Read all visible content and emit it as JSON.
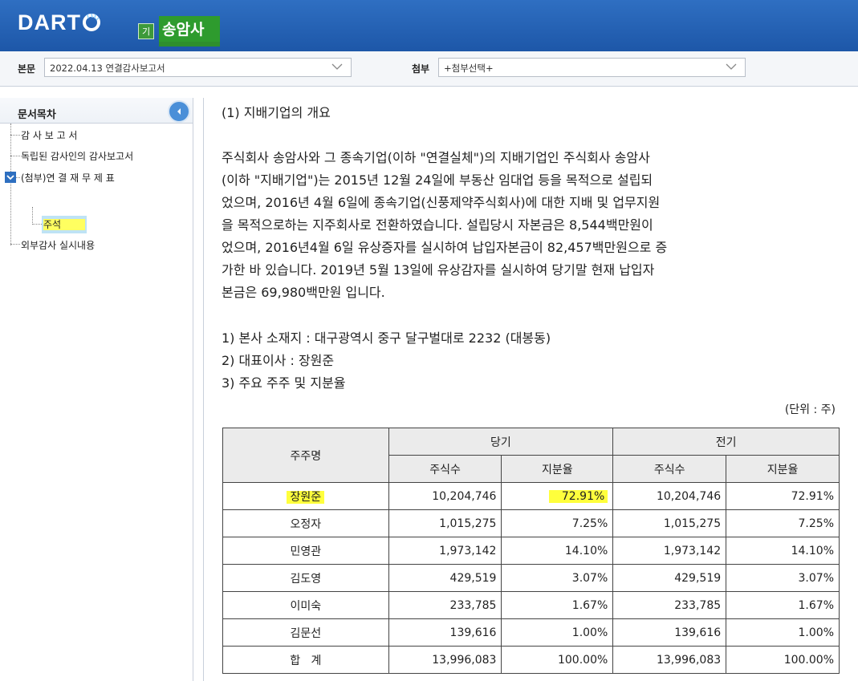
{
  "header": {
    "logo_text": "DART",
    "company_badge": "기",
    "company_name": "송암사"
  },
  "selbar": {
    "main_label": "본문",
    "main_value": "2022.04.13  연결감사보고서",
    "attach_label": "첨부",
    "attach_value": "+첨부선택+"
  },
  "sidebar": {
    "title": "문서목차",
    "items": [
      "감 사 보 고 서",
      "독립된 감사인의 감사보고서",
      "(첨부)연 결 재 무 제 표",
      "주석",
      "외부감사 실시내용"
    ]
  },
  "content": {
    "section_title": "(1) 지배기업의 개요",
    "paragraph_lines": [
      "주식회사 송암사와 그 종속기업(이하 \"연결실체\")의 지배기업인 주식회사 송암사",
      "(이하 \"지배기업\")는 2015년 12월 24일에 부동산 임대업 등을  목적으로 설립되",
      "었으며, 2016년 4월 6일에 종속기업(신풍제약주식회사)에 대한 지배 및 업무지원",
      "을 목적으로하는 지주회사로 전환하였습니다. 설립당시 자본금은 8,544백만원이",
      "었으며, 2016년4월 6일 유상증자를 실시하여 납입자본금이 82,457백만원으로 증",
      "가한 바 있습니다. 2019년 5월 13일에 유상감자를 실시하여 당기말 현재 납입자",
      "본금은 69,980백만원 입니다."
    ],
    "list_items": [
      "1) 본사 소재지 : 대구광역시 중구 달구벌대로 2232 (대봉동)",
      "2) 대표이사 : 장원준",
      "3) 주요 주주 및 지분율"
    ],
    "unit_label": "(단위 : 주)"
  },
  "table": {
    "col_shareholder": "주주명",
    "col_current": "당기",
    "col_prior": "전기",
    "col_shares": "주식수",
    "col_ratio": "지분율",
    "rows": [
      {
        "name": "장원준",
        "cur_shares": "10,204,746",
        "cur_ratio": "72.91%",
        "pri_shares": "10,204,746",
        "pri_ratio": "72.91%"
      },
      {
        "name": "오정자",
        "cur_shares": "1,015,275",
        "cur_ratio": "7.25%",
        "pri_shares": "1,015,275",
        "pri_ratio": "7.25%"
      },
      {
        "name": "민영관",
        "cur_shares": "1,973,142",
        "cur_ratio": "14.10%",
        "pri_shares": "1,973,142",
        "pri_ratio": "14.10%"
      },
      {
        "name": "김도영",
        "cur_shares": "429,519",
        "cur_ratio": "3.07%",
        "pri_shares": "429,519",
        "pri_ratio": "3.07%"
      },
      {
        "name": "이미숙",
        "cur_shares": "233,785",
        "cur_ratio": "1.67%",
        "pri_shares": "233,785",
        "pri_ratio": "1.67%"
      },
      {
        "name": "김문선",
        "cur_shares": "139,616",
        "cur_ratio": "1.00%",
        "pri_shares": "139,616",
        "pri_ratio": "1.00%"
      },
      {
        "name": "합   계",
        "cur_shares": "13,996,083",
        "cur_ratio": "100.00%",
        "pri_shares": "13,996,083",
        "pri_ratio": "100.00%"
      }
    ]
  },
  "colors": {
    "header_blue": "#1d57a8",
    "company_green": "#2e9b2e",
    "highlight_yellow": "#ffff3c"
  },
  "icons": {
    "logo_mark": "dart-logo-icon",
    "collapse": "chevron-left-icon",
    "dropdown": "chevron-down-icon",
    "expander": "tree-collapse-icon"
  }
}
